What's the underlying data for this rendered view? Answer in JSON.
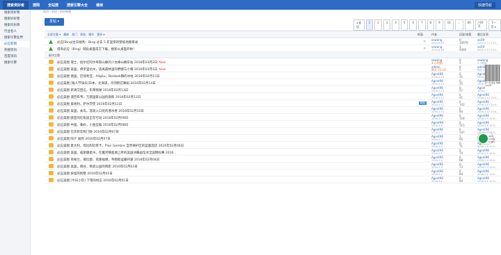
{
  "topbar": {
    "nav": [
      "搜索资好者",
      "搜网",
      "全站搜",
      "搜索引擎大全",
      "继续"
    ],
    "user": "快捷导航"
  },
  "sidebar": {
    "items": [
      "搜索资好者",
      "搜索好好者",
      "搜索问乐情",
      "行业名人",
      "搜索引擎业界",
      "必应新图",
      "热搜资讯",
      "百度资讯",
      "搜索引擎"
    ]
  },
  "breadcrumb": "首页 › 必应 › 必应新图",
  "post_button": "发帖 ▾",
  "pager": [
    "◂ 返回",
    "1",
    "2",
    "3",
    "4",
    "5",
    "6",
    "7",
    "8",
    "9",
    "10",
    "...",
    "69",
    "/ 69 页",
    "下一页 ▸"
  ],
  "header": {
    "tabs": [
      "全部主题 ▾",
      "最新",
      "热门",
      "热帖",
      "精华",
      "更多 ▾"
    ],
    "new_window": "新窗",
    "author": "作者",
    "replies_views": "回复/查看",
    "last_post": "最后发表"
  },
  "pinned": [
    {
      "title": "必应[Bing]主日福利：Bing 过去 5 年里受的壁纸地图目录",
      "author": "sowang",
      "date": "2014-6-19",
      "num1": "0",
      "num2": "10979",
      "last": "ae39",
      "last_date": "2015-2-13 13:1..."
    },
    {
      "title": "借资必应（Bing）域投桌面常方下载，搜索从桌面开始！",
      "author": "sowang",
      "date": "2014-6-18",
      "num1": "1",
      "num2": "4480",
      "last": "ae39",
      "last_date": "2015-2-13 13:1..."
    }
  ],
  "section_label": "板块主题",
  "threads": [
    {
      "title": "必应美图 瑞士，伯尔尼阿尔卑斯山脉的少女峰山端车站 2016年03月2日",
      "new": "New",
      "author": "sowang",
      "author_extra": "3 小时前",
      "num1": "0",
      "num2": "4",
      "last": "sowang",
      "last_date": "3 小时前"
    },
    {
      "title": "必应美图 美国，佛罗里达州，逃离森林里的野猪与小猪 2016年03月1日",
      "new": "New",
      "author": "admin",
      "author_extra": "昨天 21:10",
      "num1": "0",
      "num2": "5",
      "last": "admin",
      "last_date": "昨天 21:10"
    },
    {
      "title": "必应美图 德国，巴伐利亚，Allgäu，Bolsbek镇的冰柱 2016年02月15日",
      "new": "",
      "author": "Agent96",
      "author_extra": "2016-2-15",
      "num1": "0",
      "num2": "31",
      "last": "Agent96",
      "last_date": "2016-2-15 15:..."
    },
    {
      "title": "必应美图 [猴人节快乐]日本，北海道，丹顶鹤在舞蹈 2016年02月14日",
      "new": "",
      "author": "Agent96",
      "author_extra": "2016-2-14",
      "num1": "0",
      "num2": "35",
      "last": "Agent96",
      "last_date": "2016-2-14 15:4..."
    },
    {
      "title": "必应美图 新清交回应，布莱顿湖 2016年02月13日",
      "new": "",
      "author": "Agent96",
      "author_extra": "2016-2-13",
      "num1": "0",
      "num2": "57",
      "last": "Agent96",
      "last_date": "2016-2-13 15:0..."
    },
    {
      "title": "必应美图 澳巴布韦，万基国家公园的旗鹃 2016年02月12日",
      "new": "",
      "author": "Agent96",
      "author_extra": "2016-2-12",
      "num1": "0",
      "num2": "41",
      "last": "Agent96",
      "last_date": "2016-2-12 15:0..."
    },
    {
      "title": "必应美图 奥地利，萨尔茨堡 2016年02月11日",
      "new": "",
      "tag": "精品",
      "author": "Agent96",
      "author_extra": "2016-2-11",
      "num1": "0",
      "num2": "142",
      "last": "Agent96",
      "last_date": "2016-2-11 15:0..."
    },
    {
      "title": "必应美图 美国，关岛，温润入口处的潜水者 2016年02月10日",
      "new": "",
      "author": "Agent96",
      "author_extra": "2016-2-10",
      "num1": "0",
      "num2": "84",
      "last": "Agent96",
      "last_date": "2016-2-10 15:0..."
    },
    {
      "title": "必应美图 欧亚的红松鼠正在行动 2016年02月09日",
      "new": "",
      "author": "Agent96",
      "author_extra": "2016-2-9",
      "num1": "0",
      "num2": "118",
      "last": "Agent96",
      "last_date": "2016-2-9 15:0..."
    },
    {
      "title": "必应美图 中国，秦岭，小金丝猴 2016年02月08日",
      "new": "",
      "author": "Agent96",
      "author_extra": "2016-2-8",
      "num1": "0",
      "num2": "115",
      "last": "Agent96",
      "last_date": "2016-2-8 15:0..."
    },
    {
      "title": "必应美图 在庆新年和门联 2016年02月07日",
      "new": "",
      "author": "Agent96",
      "author_extra": "2016-2-7",
      "num1": "0",
      "num2": "147",
      "last": "Agent96",
      "last_date": "2016-2-7 15:0..."
    },
    {
      "title": "必应美图 除夕 福到 2016年02月07日",
      "new": "",
      "author": "Agent96",
      "author_extra": "2016-2-7",
      "num1": "1",
      "num2": "95",
      "last": "sowang",
      "last_date": "2016-2-7 17:0..."
    },
    {
      "title": "必应美图 意大利，塔比附近草卡，Pian Gembro 自然保护区的蓝鹿酒店 2016年02月06日",
      "new": "",
      "author": "Agent96",
      "author_extra": "2016-2-6",
      "num1": "0",
      "num2": "71",
      "last": "Agent96",
      "last_date": "2016-2-6 15:0..."
    },
    {
      "title": "必应美图 美国，威斯康星州，在魔河镇金湖上所的美国冰蝶画馆冰全国锦标赛 2016...",
      "new": "",
      "author": "Agent96",
      "author_extra": "2016-2-5",
      "num1": "0",
      "num2": "70",
      "last": "Agent96",
      "last_date": "2016-2-5 15:0..."
    },
    {
      "title": "必应美图 英格兰，德比郡，克隆福德，韦勒斯运输开湖 2016年02月04日",
      "new": "",
      "author": "Agent96",
      "author_extra": "2016-2-4",
      "num1": "0",
      "num2": "68",
      "last": "Agent96",
      "last_date": "2016-2-4 15:0..."
    },
    {
      "title": "必应美图 美国，俄谷，南瓷公园的情影 2016年02月03日",
      "new": "",
      "author": "Agent96",
      "author_extra": "2016-2-3",
      "num1": "0",
      "num2": "73",
      "last": "Agent96",
      "last_date": "2016-2-3 15:0..."
    },
    {
      "title": "必应美图 妖怪的别墅 2016年02月02日",
      "new": "",
      "author": "Agent96",
      "author_extra": "2016-2-2",
      "num1": "0",
      "num2": "84",
      "last": "Agent96",
      "last_date": "2016-2-2 15:0..."
    },
    {
      "title": "必应美图 [今日小年] 下雪的村庄 2016年02月01日",
      "new": "",
      "author": "Agent96",
      "author_extra": "2016-2-1",
      "num1": "0",
      "num2": "60",
      "last": "Agent96",
      "last_date": "2016-2-1 15:0..."
    }
  ],
  "qr_caption": "扫一扫关注 微信公众号",
  "float_widget": [
    "46%",
    "0.1K/s",
    "0.5K/s"
  ]
}
